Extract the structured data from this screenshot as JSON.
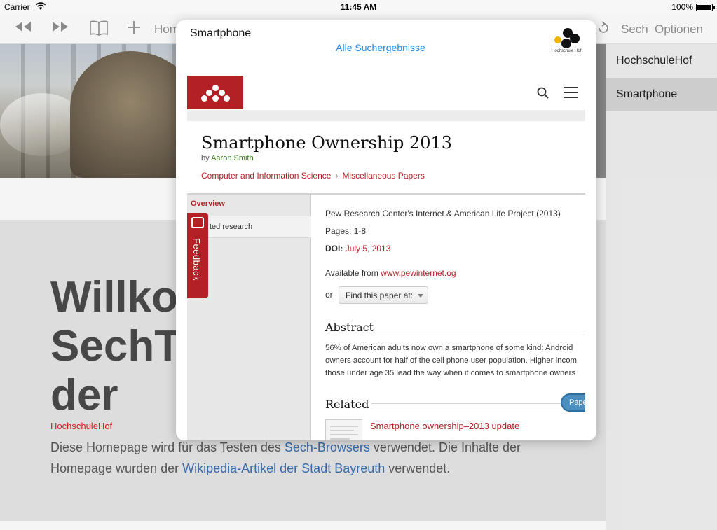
{
  "status_bar": {
    "carrier": "Carrier",
    "time": "11:45 AM",
    "battery": "100%"
  },
  "toolbar": {
    "home_label": "Hom",
    "search_label": "Sech",
    "options_label": "Optionen"
  },
  "side_panel": {
    "items": [
      {
        "label": "HochschuleHof",
        "active": false
      },
      {
        "label": "Smartphone",
        "active": true
      }
    ]
  },
  "background_page": {
    "title_lines": [
      "Willko",
      "SechT",
      "der"
    ],
    "subtitle": "HochschuleHof",
    "paragraph": {
      "part1": "Diese Homepage wird für das Testen des ",
      "link1": "Sech-Browsers",
      "part2": " verwendet. Die Inhalte der Homepage wurden der ",
      "link2": "Wikipedia-Artikel der Stadt Bayreuth",
      "part3": " verwendet."
    }
  },
  "popover": {
    "title": "Smartphone",
    "all_results_link": "Alle Suchergebnisse",
    "logo_caption": "Hochschule Hof"
  },
  "paper": {
    "title": "Smartphone Ownership 2013",
    "author_prefix": "by",
    "author": "Aaron Smith",
    "breadcrumbs": [
      "Computer and Information Science",
      "Miscellaneous Papers"
    ],
    "breadcrumb_sep": "›",
    "nav": {
      "overview": "Overview",
      "related_research": "Related research",
      "related_research_visible": "ted research",
      "feedback": "Feedback"
    },
    "source": "Pew Research Center's Internet & American Life Project (2013)",
    "pages_label": "Pages: 1-8",
    "doi_label": "DOI:",
    "doi_value": "July 5, 2013",
    "available_prefix": "Available from",
    "available_link": "www.pewinternet.og",
    "or_label": "or",
    "find_select": "Find this paper at:",
    "abstract_heading": "Abstract",
    "abstract_lines": [
      "56% of American adults now own a smartphone of some kind: Android",
      "owners account for half of the cell phone user population. Higher incom",
      "those under age 35 lead the way when it comes to smartphone owners"
    ],
    "related_heading": "Related",
    "related_pill": "Pape",
    "related_item": "Smartphone ownership–2013 update"
  }
}
